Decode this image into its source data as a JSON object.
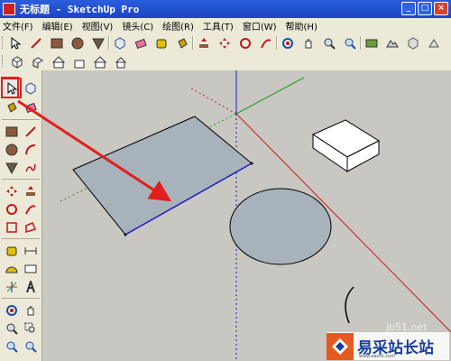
{
  "window": {
    "title": "无标题 - SketchUp Pro"
  },
  "menu": [
    "文件(F)",
    "编辑(E)",
    "视图(V)",
    "镜头(C)",
    "绘图(R)",
    "工具(T)",
    "窗口(W)",
    "帮助(H)"
  ],
  "toolbar_main": [
    "select-icon",
    "pencil-icon",
    "rectangle-icon",
    "circle-icon",
    "polygon-icon",
    "make-component-icon",
    "eraser-icon",
    "tape-measure-icon",
    "paint-bucket-icon",
    "push-pull-icon",
    "move-icon",
    "rotate-icon",
    "follow-me-icon",
    "orbit-icon",
    "pan-icon",
    "zoom-icon",
    "zoom-extents-icon",
    "add-location-icon",
    "toggle-terrain-icon",
    "get-models-icon"
  ],
  "toolbar_views": [
    "iso-view-icon",
    "top-view-icon",
    "front-view-icon",
    "right-view-icon",
    "back-view-icon",
    "left-view-icon"
  ],
  "left_toolbar": [
    "select-icon",
    "make-component-icon",
    "paint-bucket-icon",
    "eraser-icon",
    "rectangle-icon",
    "line-icon",
    "circle-icon",
    "arc-icon",
    "polygon-icon",
    "freehand-icon",
    "move-icon",
    "push-pull-icon",
    "rotate-icon",
    "follow-me-icon",
    "scale-icon",
    "offset-icon",
    "tape-measure-icon",
    "dimension-icon",
    "protractor-icon",
    "text-icon",
    "axes-icon",
    "3d-text-icon",
    "orbit-icon",
    "pan-icon",
    "zoom-icon",
    "zoom-window-icon",
    "previous-view-icon",
    "zoom-extents-icon"
  ],
  "selected_tool": "select-icon",
  "annotation_color": "#e0201c",
  "axis_colors": {
    "red": "#c81e1e",
    "green": "#1e9e1e",
    "blue": "#1e1ec8"
  },
  "watermark": {
    "url": "jb51.net",
    "brand": "易采站长站",
    "sub": "www.easck.com"
  }
}
